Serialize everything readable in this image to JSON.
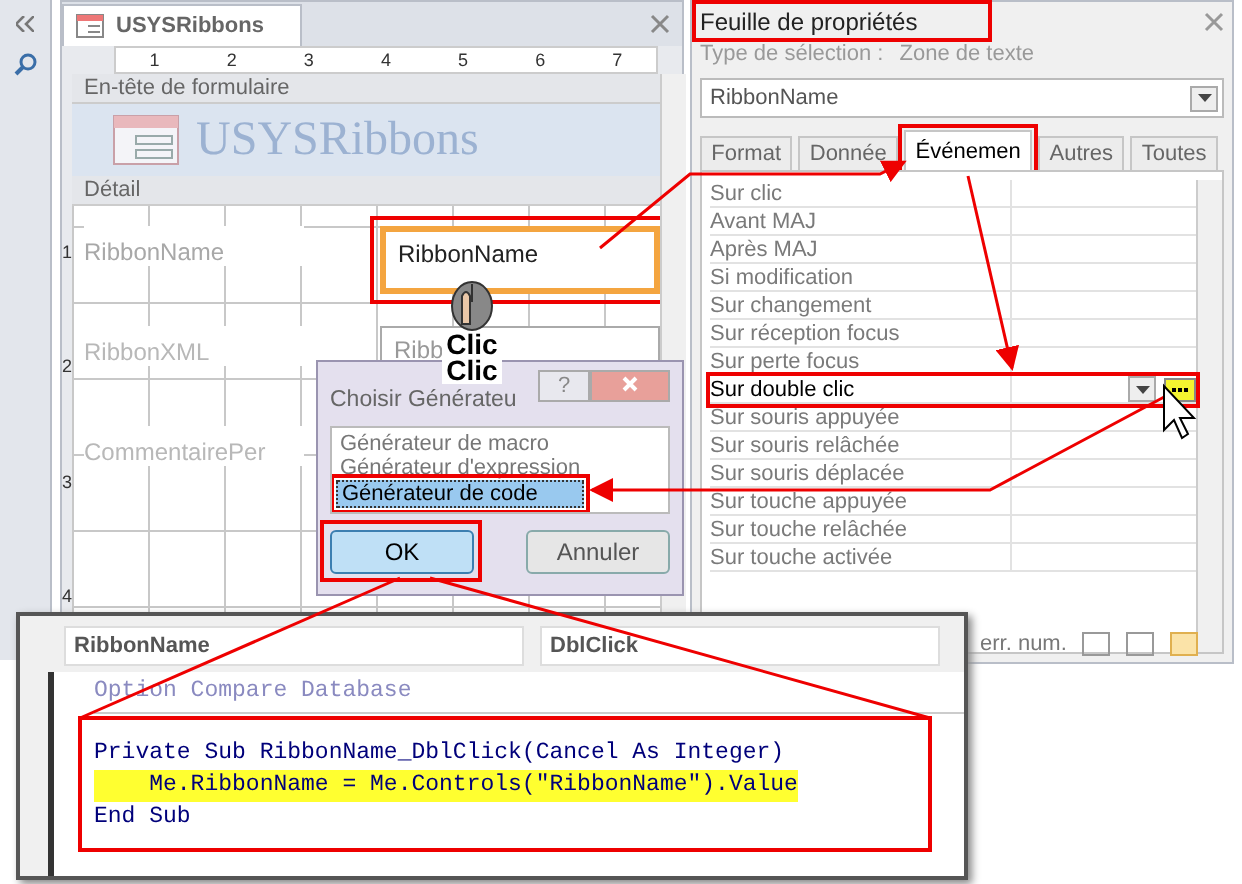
{
  "form": {
    "tab_title": "USYSRibbons",
    "ruler_marks": [
      "1",
      "2",
      "3",
      "4",
      "5",
      "6",
      "7"
    ],
    "side_marks": [
      "1",
      "2",
      "3",
      "4"
    ],
    "header_section": "En-tête de formulaire",
    "header_title": "USYSRibbons",
    "detail_section": "Détail",
    "fields": [
      {
        "label": "RibbonName",
        "value": "RibbonName",
        "selected": true
      },
      {
        "label": "RibbonXML",
        "value": "Ribb",
        "selected": false
      },
      {
        "label": "CommentairePer",
        "selected": false
      }
    ]
  },
  "property_sheet": {
    "title": "Feuille de propriétés",
    "selection_type_label": "Type de sélection :",
    "selection_type": "Zone de texte",
    "object": "RibbonName",
    "tabs": [
      {
        "label": "Format",
        "selected": false
      },
      {
        "label": "Donnée",
        "selected": false
      },
      {
        "label": "Événemen",
        "selected": true
      },
      {
        "label": "Autres",
        "selected": false
      },
      {
        "label": "Toutes",
        "selected": false
      }
    ],
    "rows": [
      {
        "label": "Sur clic",
        "selected": false
      },
      {
        "label": "Avant MAJ",
        "selected": false
      },
      {
        "label": "Après MAJ",
        "selected": false
      },
      {
        "label": "Si modification",
        "selected": false
      },
      {
        "label": "Sur changement",
        "selected": false
      },
      {
        "label": "Sur réception focus",
        "selected": false
      },
      {
        "label": "Sur perte focus",
        "selected": false
      },
      {
        "label": "Sur double clic",
        "selected": true
      },
      {
        "label": "Sur souris appuyée",
        "selected": false
      },
      {
        "label": "Sur souris relâchée",
        "selected": false
      },
      {
        "label": "Sur souris déplacée",
        "selected": false
      },
      {
        "label": "Sur touche appuyée",
        "selected": false
      },
      {
        "label": "Sur touche relâchée",
        "selected": false
      },
      {
        "label": "Sur touche activée",
        "selected": false
      }
    ],
    "status": "err. num."
  },
  "click_badge": [
    "Clic",
    "Clic"
  ],
  "dialog": {
    "title": "Choisir Générateu",
    "help": "?",
    "items": [
      {
        "label": "Générateur de macro",
        "selected": false
      },
      {
        "label": "Générateur d'expression",
        "selected": false
      },
      {
        "label": "Générateur de code",
        "selected": true
      }
    ],
    "buttons": [
      "OK",
      "Annuler"
    ]
  },
  "code_window": {
    "object": "RibbonName",
    "procedure": "DblClick",
    "lines": [
      {
        "text": "Option Compare Database",
        "kind": "dim",
        "highlighted": false
      },
      {
        "text": "Private Sub RibbonName_DblClick(Cancel As Integer)",
        "kind": "code",
        "highlighted": false
      },
      {
        "text": "    Me.RibbonName = Me.Controls(\"RibbonName\").Value",
        "kind": "code",
        "highlighted": true
      },
      {
        "text": "End Sub",
        "kind": "code",
        "highlighted": false
      }
    ]
  }
}
